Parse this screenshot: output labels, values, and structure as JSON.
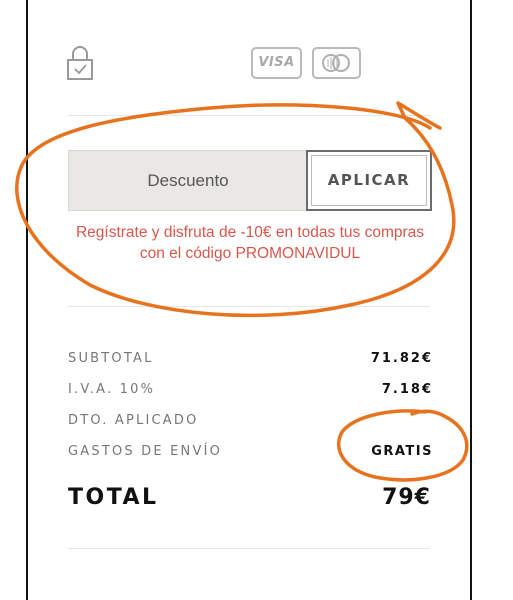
{
  "icons": {
    "lock": "lock-icon",
    "visa": "visa-card-icon",
    "mastercard": "mastercard-icon"
  },
  "card_visa_label": "VISA",
  "discount": {
    "placeholder": "Descuento",
    "apply_label": "APLICAR"
  },
  "promo_message": "Regístrate y disfruta de -10€ en todas tus compras con el código PROMONAVIDUL",
  "summary": {
    "rows": [
      {
        "label": "SUBTOTAL",
        "value": "71.82€"
      },
      {
        "label": "I.V.A. 10%",
        "value": "7.18€"
      },
      {
        "label": "DTO. APLICADO",
        "value": ""
      },
      {
        "label": "GASTOS DE ENVÍO",
        "value": "GRATIS"
      }
    ],
    "total_label": "TOTAL",
    "total_value": "79€"
  },
  "colors": {
    "promo_red": "#d8574b",
    "annotation_orange": "#e8731f",
    "input_bg": "#eae8e4"
  }
}
